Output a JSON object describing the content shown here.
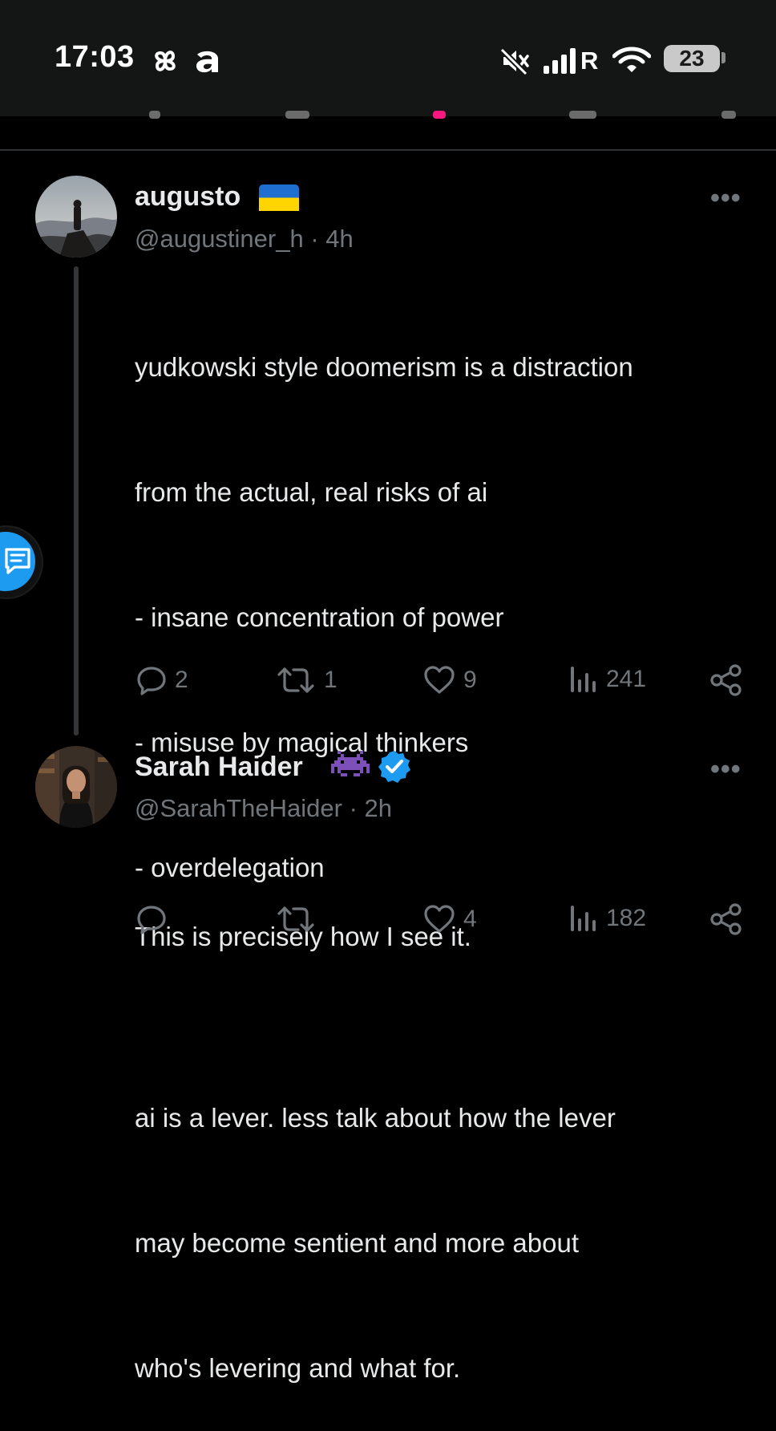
{
  "status_bar": {
    "time": "17:03",
    "battery": "23",
    "network_label": "R"
  },
  "posts": [
    {
      "name": "augusto",
      "flag": "Ukraine flag",
      "handle": "@augustiner_h",
      "time": "4h",
      "body_lines": [
        "yudkowski style doomerism is a distraction",
        "from the actual, real risks of ai",
        "- insane concentration of power",
        "- misuse by magical thinkers",
        "- overdelegation",
        "",
        "ai is a lever. less talk about how the lever",
        "may become sentient and more about",
        "who's levering and what for."
      ],
      "replies": "2",
      "reposts": "1",
      "likes": "9",
      "views": "241"
    },
    {
      "name": "Sarah Haider",
      "badges": [
        "space-invader",
        "verified"
      ],
      "handle": "@SarahTheHaider",
      "time": "2h",
      "body_lines": [
        "This is precisely how I see it."
      ],
      "replies": "",
      "reposts": "",
      "likes": "4",
      "views": "182"
    }
  ],
  "meta_separator": "·",
  "more_label": "•••",
  "colors": {
    "background": "#000000",
    "text": "#e7e9ea",
    "muted": "#71767b",
    "accent": "#1d9bf0",
    "divider": "#2f3336"
  },
  "icons": [
    "mute-icon",
    "signal-icon",
    "wifi-icon",
    "reply-icon",
    "repost-icon",
    "like-icon",
    "views-icon",
    "share-icon",
    "verified-icon",
    "space-invader-icon"
  ]
}
